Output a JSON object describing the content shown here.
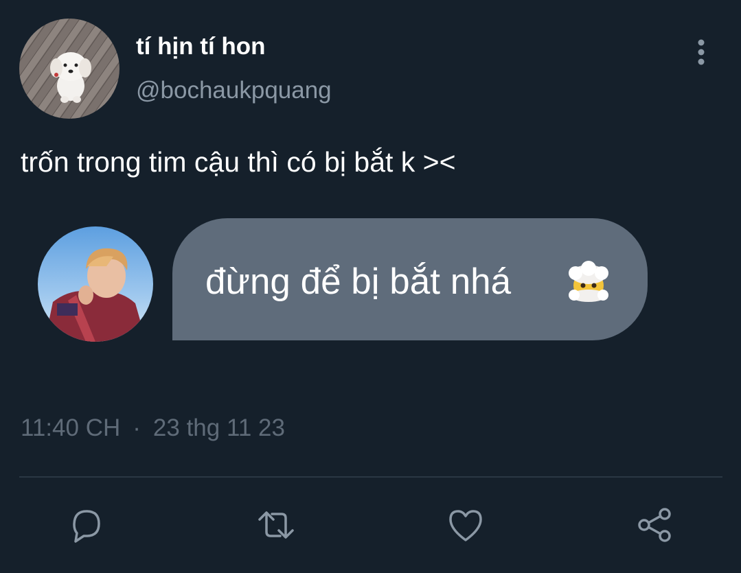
{
  "tweet": {
    "author": {
      "display_name": "tí hịn tí hon",
      "handle": "@bochaukpquang"
    },
    "text": "trốn trong tim cậu thì có bị bắt k ><",
    "embedded_reply": {
      "text": "đừng để bị bắt nhá",
      "emoji_icon": "exploding-head-emoji"
    },
    "time": "11:40 CH",
    "separator": "·",
    "date": "23 thg 11 23"
  },
  "actions": [
    {
      "name": "reply",
      "icon": "speech-bubble-icon"
    },
    {
      "name": "retweet",
      "icon": "retweet-icon"
    },
    {
      "name": "like",
      "icon": "heart-icon"
    },
    {
      "name": "share",
      "icon": "share-icon"
    }
  ],
  "colors": {
    "background": "#15202b",
    "primary_text": "#ffffff",
    "secondary_text": "#8b98a5",
    "bubble": "#5f6c7b",
    "icon": "#8b98a5"
  }
}
